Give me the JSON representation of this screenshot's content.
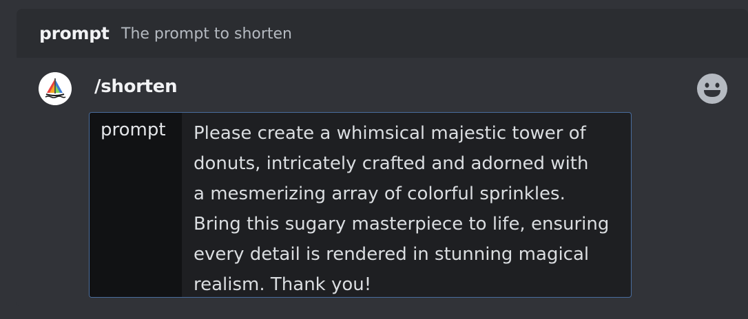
{
  "option": {
    "name": "prompt",
    "description": "The prompt to shorten"
  },
  "command": {
    "name": "/shorten",
    "avatar_icon": "midjourney-boat-icon",
    "emoji_icon": "smiley-face-icon"
  },
  "input": {
    "label": "prompt",
    "value": "Please create a whimsical majestic tower of\ndonuts, intricately crafted and adorned with\na mesmerizing array of colorful sprinkles.\nBring this sugary masterpiece to life, ensuring\nevery detail is rendered in stunning magical\nrealism. Thank you!"
  },
  "colors": {
    "background": "#313338",
    "header": "#2b2d31",
    "input_border": "#4a6e9f",
    "input_bg": "#1e1f22"
  }
}
